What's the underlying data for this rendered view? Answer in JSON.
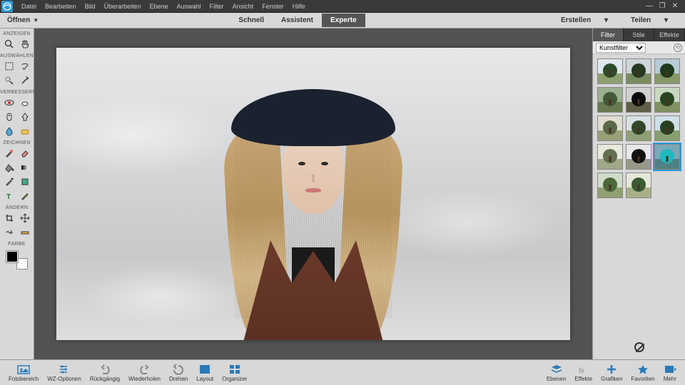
{
  "menubar": {
    "items": [
      "Datei",
      "Bearbeiten",
      "Bild",
      "Überarbeiten",
      "Ebene",
      "Auswahl",
      "Filter",
      "Ansicht",
      "Fenster",
      "Hilfe"
    ]
  },
  "modebar": {
    "open": "Öffnen",
    "tabs": [
      "Schnell",
      "Assistent",
      "Experte"
    ],
    "active": 2,
    "right": [
      "Erstellen",
      "Teilen"
    ]
  },
  "toolbar": {
    "sections": [
      {
        "label": "ANZEIGEN",
        "tools": [
          "zoom",
          "hand"
        ]
      },
      {
        "label": "AUSWÄHLEN",
        "tools": [
          "marquee",
          "lasso",
          "quick-select",
          "magic-wand"
        ]
      },
      {
        "label": "VERBESSERN",
        "tools": [
          "eye",
          "whiten",
          "spot-heal",
          "healing-brush",
          "blur",
          "sponge"
        ]
      },
      {
        "label": "ZEICHNEN",
        "tools": [
          "brush",
          "eraser",
          "fill",
          "gradient",
          "picker",
          "shape",
          "type",
          "pencil"
        ]
      },
      {
        "label": "ÄNDERN",
        "tools": [
          "crop",
          "move",
          "recompose",
          "straighten"
        ]
      },
      {
        "label": "FARBE",
        "tools": []
      }
    ]
  },
  "rightPanel": {
    "tabs": [
      "Filter",
      "Stile",
      "Effekte"
    ],
    "active": 0,
    "dropdown": "Kunstfilter",
    "thumbs": [
      {
        "sky": "#dfe8ee",
        "ground": "#8fa070",
        "tree": "#2d4a2a"
      },
      {
        "sky": "#cfd6da",
        "ground": "#7a8a60",
        "tree": "#253a22"
      },
      {
        "sky": "#b8ccd8",
        "ground": "#87986a",
        "tree": "#1e3a1a"
      },
      {
        "sky": "#9ab090",
        "ground": "#6a7a50",
        "tree": "#405838"
      },
      {
        "sky": "#d0d0d0",
        "ground": "#606048",
        "tree": "#0a0a0a"
      },
      {
        "sky": "#c8d8c0",
        "ground": "#809060",
        "tree": "#2a4422"
      },
      {
        "sky": "#e0ddd0",
        "ground": "#98a078",
        "tree": "#586848"
      },
      {
        "sky": "#d8e0e4",
        "ground": "#90a078",
        "tree": "#304828"
      },
      {
        "sky": "#cde0e8",
        "ground": "#88a070",
        "tree": "#284020"
      },
      {
        "sky": "#e8e8dc",
        "ground": "#a0a888",
        "tree": "#607050"
      },
      {
        "sky": "#e8e8e8",
        "ground": "#989888",
        "tree": "#101010"
      },
      {
        "sky": "#7aa8b8",
        "ground": "#508080",
        "tree": "#20b8c0",
        "sel": true
      },
      {
        "sky": "#d0dcc8",
        "ground": "#90a070",
        "tree": "#4a6838"
      },
      {
        "sky": "#e4e8d8",
        "ground": "#a8b088",
        "tree": "#3a5a30"
      }
    ]
  },
  "bottombar": {
    "left": [
      {
        "id": "photo-bin",
        "label": "Fotobereich"
      },
      {
        "id": "tool-options",
        "label": "WZ-Optionen"
      },
      {
        "id": "undo",
        "label": "Rückgängig"
      },
      {
        "id": "redo",
        "label": "Wiederholen"
      },
      {
        "id": "rotate",
        "label": "Drehen"
      },
      {
        "id": "layout",
        "label": "Layout"
      },
      {
        "id": "organizer",
        "label": "Organizer"
      }
    ],
    "right": [
      {
        "id": "layers",
        "label": "Ebenen"
      },
      {
        "id": "effects",
        "label": "Effekte"
      },
      {
        "id": "graphics",
        "label": "Grafiken"
      },
      {
        "id": "favorites",
        "label": "Favoriten"
      },
      {
        "id": "more",
        "label": "Mehr"
      }
    ]
  },
  "colors": {
    "accent": "#2a9bd6"
  }
}
